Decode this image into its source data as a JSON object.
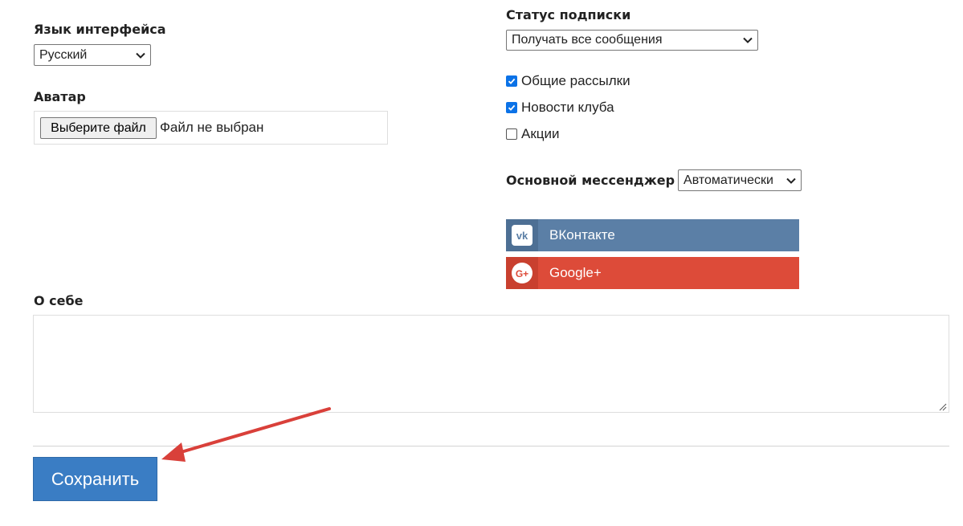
{
  "left": {
    "language": {
      "label": "Язык интерфейса",
      "selected": "Русский"
    },
    "avatar": {
      "label": "Аватар",
      "button_label": "Выберите файл",
      "status_text": "Файл не выбран"
    }
  },
  "right": {
    "subscription": {
      "label": "Статус подписки",
      "selected": "Получать все сообщения",
      "checkboxes": [
        {
          "label": "Общие рассылки",
          "checked": true
        },
        {
          "label": "Новости клуба",
          "checked": true
        },
        {
          "label": "Акции",
          "checked": false
        }
      ]
    },
    "messenger": {
      "label": "Основной мессенджер",
      "selected": "Автоматически"
    },
    "social": [
      {
        "label": "ВКонтакте",
        "icon": "vk-icon",
        "color": "#5b7fa6"
      },
      {
        "label": "Google+",
        "icon": "google-plus-icon",
        "color": "#dd4b39"
      }
    ]
  },
  "about": {
    "label": "О себе",
    "value": ""
  },
  "save": {
    "label": "Сохранить",
    "color": "#3a7dc4"
  },
  "annotation": {
    "arrow_color": "#d9403a"
  }
}
